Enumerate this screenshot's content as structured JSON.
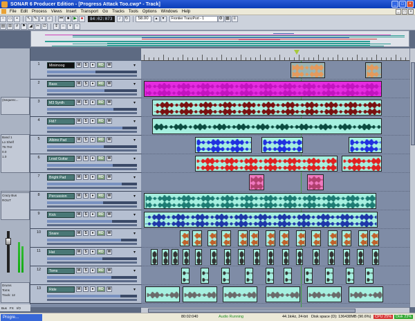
{
  "window": {
    "title": "SONAR 6 Producer Edition - [Progress Attack Too.cwp* - Track]",
    "controls": [
      "_",
      "□",
      "×"
    ]
  },
  "menu": {
    "items": [
      "File",
      "Edit",
      "Process",
      "Views",
      "Insert",
      "Transport",
      "Go",
      "Tracks",
      "Tools",
      "Options",
      "Windows",
      "Help"
    ]
  },
  "toolbar": {
    "counter": "84:02:073",
    "tempo": "58.00",
    "transport_select": "Frontier TranzPort - 1"
  },
  "inspector": {
    "module1_label": "(Sequenc...",
    "band_label": "Band 1",
    "band_type": "Lo Shelf",
    "freq": "79.7Hz",
    "gain": "0.0",
    "q": "1.0",
    "bypass": "Bypass",
    "send_label": "Crazy Bus",
    "route_label": "ROUT",
    "out_label": "Drums",
    "out_track": "Toms",
    "out_sub": "Track: 12",
    "tabs": [
      "Bus",
      "FX",
      "I/O"
    ]
  },
  "tracks": [
    {
      "num": "1",
      "name": "Minimoog",
      "selected": true
    },
    {
      "num": "2",
      "name": "Bass"
    },
    {
      "num": "3",
      "name": "M3 Synth"
    },
    {
      "num": "4",
      "name": "FM7"
    },
    {
      "num": "5",
      "name": "Albino Pad"
    },
    {
      "num": "6",
      "name": "Lead Guitar"
    },
    {
      "num": "7",
      "name": "Bright Pad"
    },
    {
      "num": "8",
      "name": "Percussion"
    },
    {
      "num": "9",
      "name": "Kick"
    },
    {
      "num": "10",
      "name": "Snare"
    },
    {
      "num": "11",
      "name": "Hat"
    },
    {
      "num": "12",
      "name": "Toms"
    },
    {
      "num": "13",
      "name": "Ride"
    }
  ],
  "track_buttons": {
    "mute": "M",
    "solo": "S",
    "arm": "●",
    "read": "RD",
    "write": "W"
  },
  "status": {
    "task_button": "Progre...",
    "time": "80:02:040",
    "engine": "Audio Running",
    "format": "44.1kHz, 24-bit",
    "disk": "Disk space (D): 136438MB (90.6%)",
    "cpu": "CPU 25%",
    "disk_meter": "Disk 23%"
  },
  "colors": {
    "bass": "#e52ce0",
    "lead": "#e02020",
    "pad_blue": "#2030e0",
    "synth_dark": "#7a1010",
    "pink": "#f07ac0",
    "teal": "#a6f0e0",
    "orange_wave": "#e49a5c"
  }
}
